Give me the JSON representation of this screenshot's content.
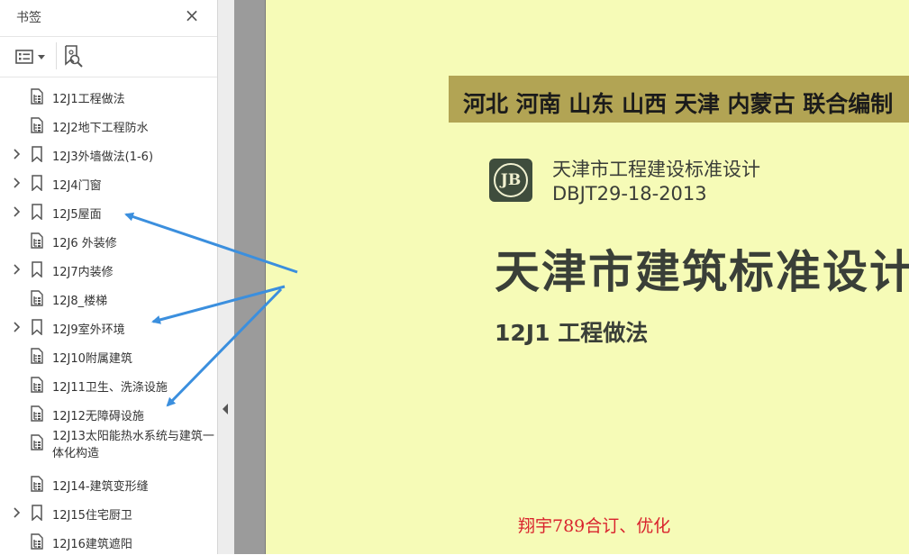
{
  "sidebar": {
    "title": "书签",
    "close_icon": "×",
    "bookmarks": [
      {
        "label": "12J1工程做法",
        "expandable": false
      },
      {
        "label": "12J2地下工程防水",
        "expandable": false
      },
      {
        "label": "12J3外墙做法(1-6)",
        "expandable": true
      },
      {
        "label": "12J4门窗",
        "expandable": true
      },
      {
        "label": "12J5屋面",
        "expandable": true
      },
      {
        "label": "12J6 外装修",
        "expandable": false
      },
      {
        "label": "12J7内装修",
        "expandable": true
      },
      {
        "label": "12J8_楼梯",
        "expandable": false
      },
      {
        "label": "12J9室外环境",
        "expandable": true
      },
      {
        "label": "12J10附属建筑",
        "expandable": false
      },
      {
        "label": "12J11卫生、洗涤设施",
        "expandable": false
      },
      {
        "label": "12J12无障碍设施",
        "expandable": false
      },
      {
        "label": "12J13太阳能热水系统与建筑一体化构造",
        "expandable": false
      },
      {
        "label": "12J14-建筑变形缝",
        "expandable": false
      },
      {
        "label": "12J15住宅厨卫",
        "expandable": true
      },
      {
        "label": "12J16建筑遮阳",
        "expandable": false
      }
    ]
  },
  "document": {
    "banner": "河北 河南 山东 山西 天津 内蒙古 联合编制",
    "logo_text": "JB",
    "standard_line": "天津市工程建设标准设计",
    "standard_code": "DBJT29-18-2013",
    "main_title": "天津市建筑标准设计",
    "subtitle": "12J1  工程做法",
    "watermark": "翔宇789合订、优化"
  },
  "colors": {
    "page_bg": "#f6fbb7",
    "banner_bg": "#b2a454",
    "arrow": "#3b8fde",
    "watermark": "#d9232d"
  }
}
